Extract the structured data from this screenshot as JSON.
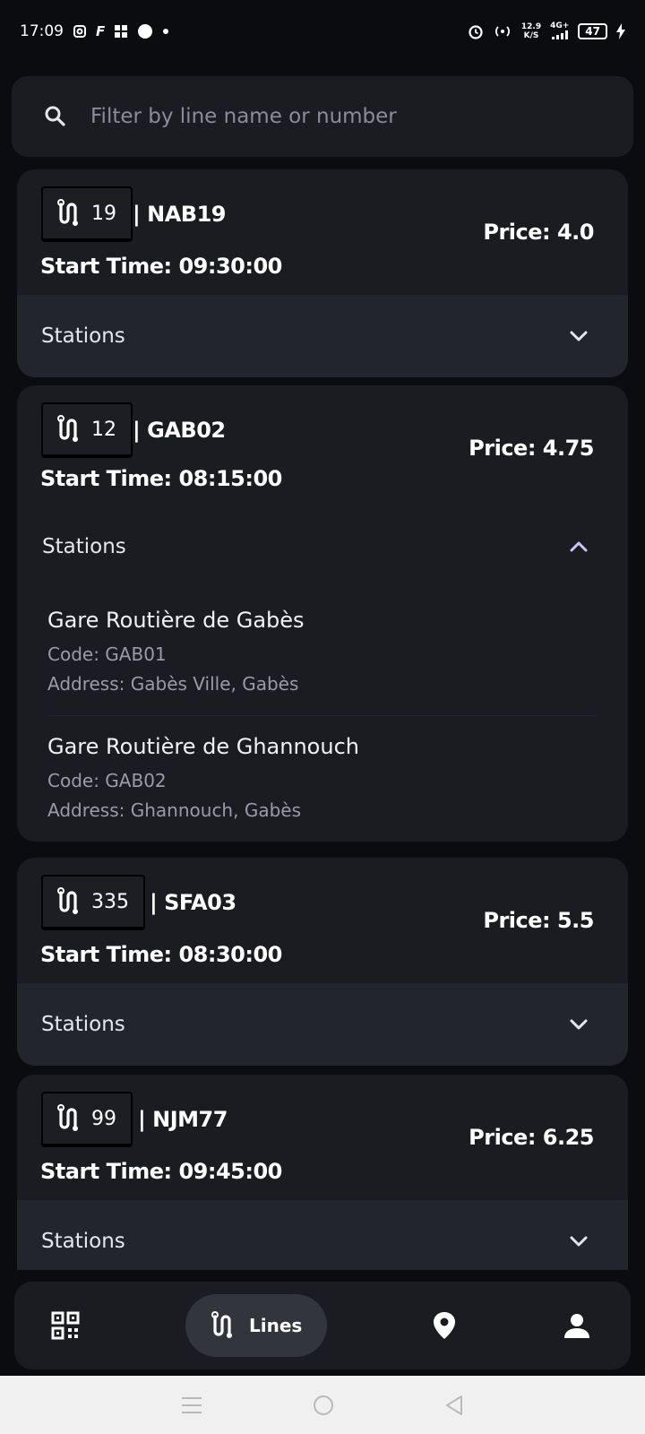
{
  "status_bar": {
    "time": "17:09",
    "left_icons": [
      "instagram-icon",
      "app-icon",
      "grid-icon",
      "circle-icon",
      "dot-icon"
    ],
    "net_speed_top": "12.9",
    "net_speed_bottom": "K/S",
    "network": "4G+",
    "battery": "47"
  },
  "search": {
    "placeholder": "Filter by line name or number"
  },
  "lines": [
    {
      "number": "19",
      "code": "| NAB19",
      "start_time": "Start Time: 09:30:00",
      "price": "Price: 4.0",
      "stations_label": "Stations",
      "expanded": false
    },
    {
      "number": "12",
      "code": "| GAB02",
      "start_time": "Start Time: 08:15:00",
      "price": "Price: 4.75",
      "stations_label": "Stations",
      "expanded": true,
      "stations": [
        {
          "name": "Gare Routière de Gabès",
          "code": "Code: GAB01",
          "address": "Address: Gabès Ville, Gabès"
        },
        {
          "name": "Gare Routière de Ghannouch",
          "code": "Code: GAB02",
          "address": "Address: Ghannouch, Gabès"
        }
      ]
    },
    {
      "number": "335",
      "code": "| SFA03",
      "start_time": "Start Time: 08:30:00",
      "price": "Price: 5.5",
      "stations_label": "Stations",
      "expanded": false
    },
    {
      "number": "99",
      "code": "| NJM77",
      "start_time": "Start Time: 09:45:00",
      "price": "Price: 6.25",
      "stations_label": "Stations",
      "expanded": false
    }
  ],
  "bottom_nav": {
    "items": [
      "qr-code-icon",
      "route-icon",
      "location-pin-icon",
      "person-icon"
    ],
    "active_label": "Lines"
  },
  "colors": {
    "background": "#0b0c10",
    "card": "#1b1c22",
    "stations_bar": "#23252d",
    "accent_chevron": "#c9c7f5"
  }
}
